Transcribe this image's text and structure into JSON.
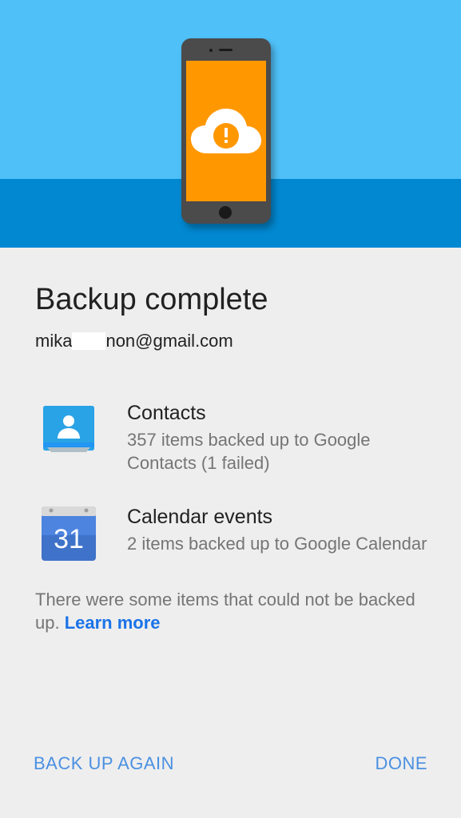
{
  "colors": {
    "hero_top": "#4fc0f8",
    "hero_bottom": "#0288d1",
    "phone_screen": "#ff9800",
    "accent": "#1a73e8",
    "button": "#4a90e2"
  },
  "header": {
    "title": "Backup complete",
    "account_prefix": "mika",
    "account_suffix": "non@gmail.com"
  },
  "items": [
    {
      "icon": "contacts-icon",
      "title": "Contacts",
      "description": "357 items backed up to Google Contacts (1 failed)"
    },
    {
      "icon": "calendar-icon",
      "title": "Calendar events",
      "description": "2 items backed up to Google Calendar",
      "calendar_day": "31"
    }
  ],
  "note": {
    "text": "There were some items that could not be backed up. ",
    "link": "Learn more"
  },
  "actions": {
    "back_up_again": "BACK UP AGAIN",
    "done": "DONE"
  }
}
